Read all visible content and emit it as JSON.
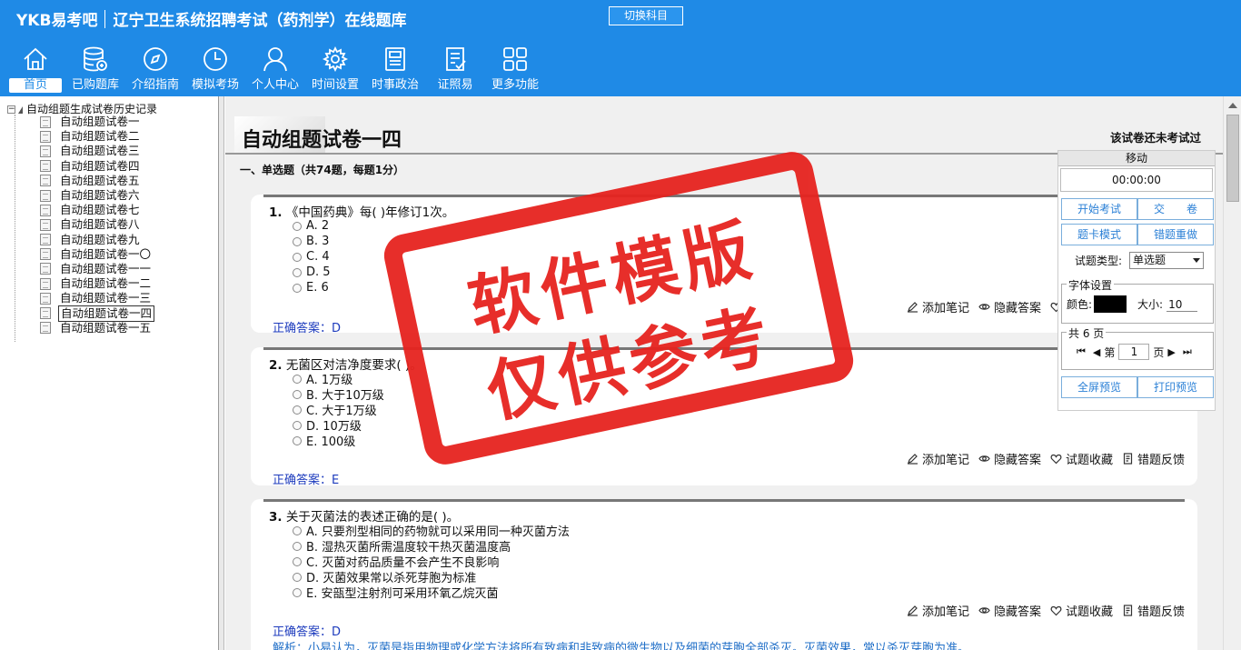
{
  "header": {
    "brand": "YKB易考吧",
    "subtitle": "辽宁卫生系统招聘考试（药剂学）在线题库",
    "switch_label": "切换科目",
    "nav": [
      {
        "label": "首页",
        "icon": "home-icon",
        "active": true
      },
      {
        "label": "已购题库",
        "icon": "database-icon"
      },
      {
        "label": "介绍指南",
        "icon": "compass-icon"
      },
      {
        "label": "模拟考场",
        "icon": "clock-icon"
      },
      {
        "label": "个人中心",
        "icon": "user-icon"
      },
      {
        "label": "时间设置",
        "icon": "gear-icon"
      },
      {
        "label": "时事政治",
        "icon": "newspaper-icon"
      },
      {
        "label": "证照易",
        "icon": "checklist-icon"
      },
      {
        "label": "更多功能",
        "icon": "grid-icon"
      }
    ]
  },
  "sidebar": {
    "root_label": "自动组题生成试卷历史记录",
    "items": [
      "自动组题试卷一",
      "自动组题试卷二",
      "自动组题试卷三",
      "自动组题试卷四",
      "自动组题试卷五",
      "自动组题试卷六",
      "自动组题试卷七",
      "自动组题试卷八",
      "自动组题试卷九",
      "自动组题试卷一〇",
      "自动组题试卷一一",
      "自动组题试卷一二",
      "自动组题试卷一三",
      "自动组题试卷一四",
      "自动组题试卷一五"
    ],
    "selected_index": 13
  },
  "paper": {
    "title": "自动组题试卷一四",
    "status": "该试卷还未考试过",
    "section": "一、单选题（共74题，每题1分）"
  },
  "actions": {
    "note": "添加笔记",
    "hide": "隐藏答案",
    "fav": "试题收藏",
    "report": "错题反馈"
  },
  "questions": [
    {
      "num": "1.",
      "stem": "《中国药典》每(  )年修订1次。",
      "options": [
        "A. 2",
        "B. 3",
        "C. 4",
        "D. 5",
        "E. 6"
      ],
      "answer": "正确答案：D"
    },
    {
      "num": "2.",
      "stem": "无菌区对洁净度要求(  )。",
      "options": [
        "A. 1万级",
        "B. 大于10万级",
        "C. 大于1万级",
        "D. 10万级",
        "E. 100级"
      ],
      "answer": "正确答案：E"
    },
    {
      "num": "3.",
      "stem": "关于灭菌法的表述正确的是(  )。",
      "options": [
        "A. 只要剂型相同的药物就可以采用同一种灭菌方法",
        "B. 湿热灭菌所需温度较干热灭菌温度高",
        "C. 灭菌对药品质量不会产生不良影响",
        "D. 灭菌效果常以杀死芽胞为标准",
        "E. 安瓿型注射剂可采用环氧乙烷灭菌"
      ],
      "answer": "正确答案：D",
      "analysis": "解析：小易认为，灭菌是指用物理或化学方法将所有致病和非致病的微生物以及细菌的芽胞全部杀灭。灭菌效果，常以杀灭芽胞为准。"
    }
  ],
  "panel": {
    "move": "移动",
    "timer": "00:00:00",
    "start": "开始考试",
    "submit": "交　　卷",
    "card_mode": "题卡模式",
    "redo": "错题重做",
    "type_label": "试题类型:",
    "type_value": "单选题",
    "font_legend": "字体设置",
    "color_label": "颜色:",
    "size_label": "大小:",
    "size_value": "10",
    "pages_legend": "共 6 页",
    "page_prefix": "第",
    "page_value": "1",
    "page_suffix": "页",
    "fullscreen": "全屏预览",
    "print": "打印预览"
  },
  "watermark": {
    "line1": "软件模版",
    "line2": "仅供参考"
  },
  "colors": {
    "header_bg": "#1f8ae6",
    "stamp_red": "#e6231f",
    "answer_blue": "#1d3bbd"
  }
}
